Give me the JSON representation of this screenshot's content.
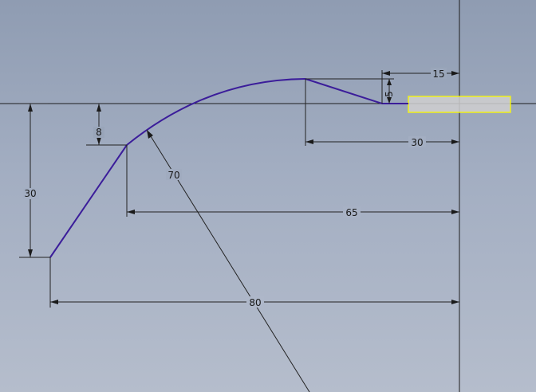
{
  "sketch": {
    "dimensions": {
      "d15": "15",
      "d5": "5",
      "d30_horizontal": "30",
      "d8": "8",
      "d70": "70",
      "d30_vertical": "30",
      "d65": "65",
      "d80": "80"
    },
    "colors": {
      "profile": "#3b1d9a",
      "selection_outline": "#ffff00",
      "selection_fill": "#d0d0d0",
      "dimension": "#1a1a1a"
    }
  }
}
